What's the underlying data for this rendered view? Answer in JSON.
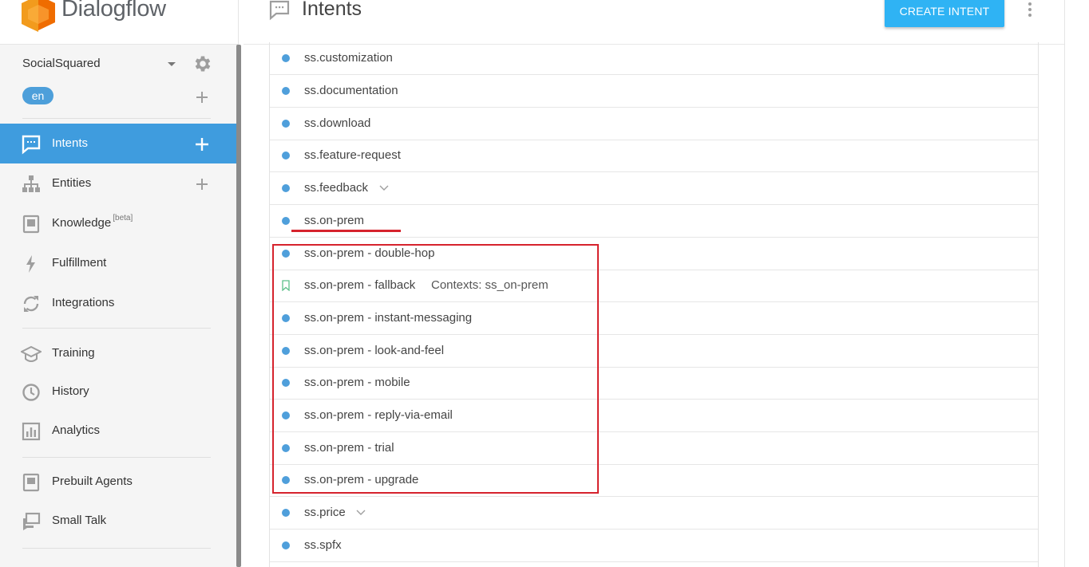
{
  "brand": {
    "name": "Dialogflow"
  },
  "agent": {
    "name": "SocialSquared",
    "language": "en"
  },
  "sidebar": {
    "items": [
      {
        "label": "Intents",
        "icon": "chat-icon",
        "active": true,
        "has_add": true
      },
      {
        "label": "Entities",
        "icon": "hierarchy-icon",
        "has_add": true
      },
      {
        "label": "Knowledge",
        "badge": "[beta]",
        "icon": "book-icon"
      },
      {
        "label": "Fulfillment",
        "icon": "bolt-icon"
      },
      {
        "label": "Integrations",
        "icon": "sync-icon"
      },
      {
        "label": "Training",
        "icon": "graduation-cap-icon"
      },
      {
        "label": "History",
        "icon": "clock-icon"
      },
      {
        "label": "Analytics",
        "icon": "bar-chart-icon"
      },
      {
        "label": "Prebuilt Agents",
        "icon": "agent-box-icon"
      },
      {
        "label": "Small Talk",
        "icon": "chat-bubbles-icon"
      }
    ]
  },
  "header": {
    "title": "Intents",
    "create_label": "CREATE INTENT"
  },
  "intents": [
    {
      "name": "ss.customization"
    },
    {
      "name": "ss.documentation"
    },
    {
      "name": "ss.download"
    },
    {
      "name": "ss.feature-request"
    },
    {
      "name": "ss.feedback",
      "expandable": true
    },
    {
      "name": "ss.on-prem"
    },
    {
      "name": "ss.on-prem - double-hop"
    },
    {
      "name": "ss.on-prem - fallback",
      "fallback": true,
      "contexts": "Contexts: ss_on-prem"
    },
    {
      "name": "ss.on-prem - instant-messaging"
    },
    {
      "name": "ss.on-prem - look-and-feel"
    },
    {
      "name": "ss.on-prem - mobile"
    },
    {
      "name": "ss.on-prem - reply-via-email"
    },
    {
      "name": "ss.on-prem - trial"
    },
    {
      "name": "ss.on-prem - upgrade"
    },
    {
      "name": "ss.price",
      "expandable": true
    },
    {
      "name": "ss.spfx"
    }
  ],
  "colors": {
    "accent": "#3f9cde",
    "create_button": "#2fb3f4",
    "intent_dot": "#4f9fdb",
    "fallback_icon": "#5cbf8a",
    "annotation_red": "#d6232d",
    "brand_orange": "#f29b1d"
  }
}
